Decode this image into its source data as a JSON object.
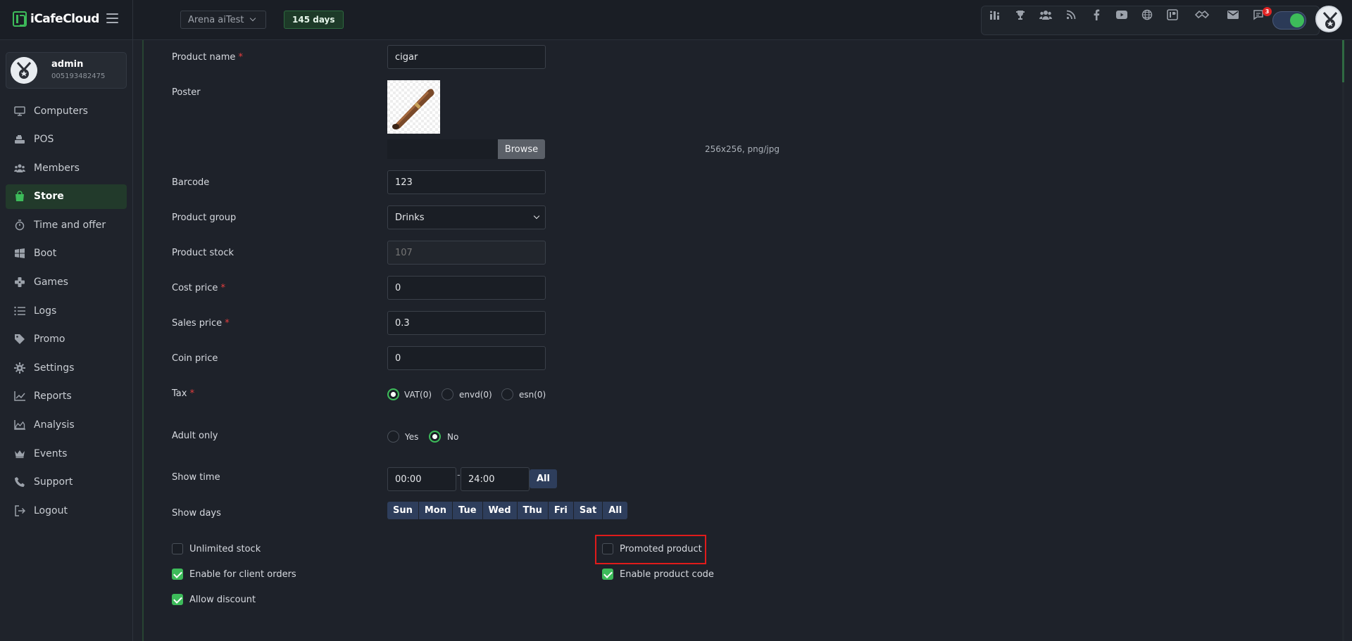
{
  "app": {
    "logo_text": "iCafeCloud",
    "accent": "#3dbb5a"
  },
  "topbar": {
    "store_name": "Arena aiTest",
    "days_badge": "145 days",
    "notification_count": "3",
    "toolbar_icons": [
      "leaderboard-icon",
      "trophy-icon",
      "group-icon",
      "rss-icon",
      "facebook-icon",
      "youtube-icon",
      "globe-icon",
      "icafe-icon",
      "handshake-icon",
      "mail-icon",
      "chat-icon"
    ],
    "toggle_on": true
  },
  "user": {
    "name": "admin",
    "id": "005193482475"
  },
  "sidebar": {
    "items": [
      {
        "label": "Computers",
        "icon": "monitor-icon"
      },
      {
        "label": "POS",
        "icon": "cash-register-icon"
      },
      {
        "label": "Members",
        "icon": "members-icon"
      },
      {
        "label": "Store",
        "icon": "shopping-bag-icon",
        "active": true
      },
      {
        "label": "Time and offer",
        "icon": "stopwatch-icon"
      },
      {
        "label": "Boot",
        "icon": "windows-icon"
      },
      {
        "label": "Games",
        "icon": "gamepad-icon"
      },
      {
        "label": "Logs",
        "icon": "list-icon"
      },
      {
        "label": "Promo",
        "icon": "tag-icon"
      },
      {
        "label": "Settings",
        "icon": "gear-icon"
      },
      {
        "label": "Reports",
        "icon": "line-chart-icon"
      },
      {
        "label": "Analysis",
        "icon": "area-chart-icon"
      },
      {
        "label": "Events",
        "icon": "crown-icon"
      },
      {
        "label": "Support",
        "icon": "phone-icon"
      },
      {
        "label": "Logout",
        "icon": "logout-icon"
      }
    ]
  },
  "form": {
    "product_name": {
      "label": "Product name",
      "required": "*",
      "value": "cigar"
    },
    "poster": {
      "label": "Poster",
      "browse_label": "Browse",
      "hint": "256x256, png/jpg"
    },
    "barcode": {
      "label": "Barcode",
      "value": "123"
    },
    "product_group": {
      "label": "Product group",
      "value": "Drinks"
    },
    "product_stock": {
      "label": "Product stock",
      "placeholder": "107"
    },
    "cost_price": {
      "label": "Cost price",
      "required": "*",
      "value": "0"
    },
    "sales_price": {
      "label": "Sales price",
      "required": "*",
      "value": "0.3"
    },
    "coin_price": {
      "label": "Coin price",
      "value": "0"
    },
    "tax": {
      "label": "Tax",
      "required": "*",
      "options": [
        "VAT(0)",
        "envd(0)",
        "esn(0)"
      ],
      "selected": "VAT(0)"
    },
    "adult_only": {
      "label": "Adult only",
      "options": [
        "Yes",
        "No"
      ],
      "selected": "No"
    },
    "show_time": {
      "label": "Show time",
      "from": "00:00",
      "separator": "-",
      "to": "24:00",
      "all_label": "All"
    },
    "show_days": {
      "label": "Show days",
      "days": [
        "Sun",
        "Mon",
        "Tue",
        "Wed",
        "Thu",
        "Fri",
        "Sat",
        "All"
      ]
    },
    "checkboxes": {
      "unlimited_stock": {
        "label": "Unlimited stock",
        "checked": false
      },
      "enable_client_orders": {
        "label": "Enable for client orders",
        "checked": true
      },
      "allow_discount": {
        "label": "Allow discount",
        "checked": true
      },
      "promoted_product": {
        "label": "Promoted product",
        "checked": false
      },
      "enable_product_code": {
        "label": "Enable product code",
        "checked": true
      }
    }
  }
}
